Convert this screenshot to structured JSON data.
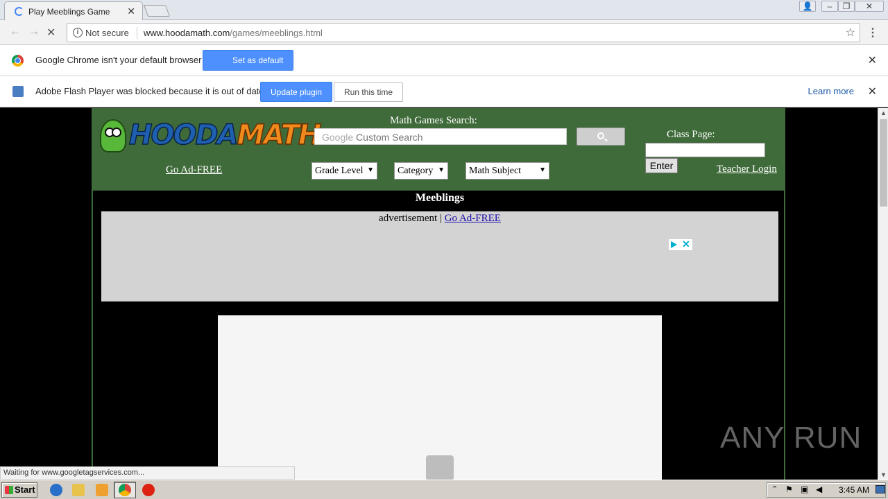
{
  "browser": {
    "tab_title": "Play Meeblings Game",
    "address": {
      "security": "Not secure",
      "host": "www.hoodamath.com",
      "path": "/games/meeblings.html"
    },
    "status_text": "Waiting for www.googletagservices.com..."
  },
  "infobar_default": {
    "message": "Google Chrome isn't your default browser",
    "button": "Set as default"
  },
  "infobar_flash": {
    "message": "Adobe Flash Player was blocked because it is out of date",
    "update_button": "Update plugin",
    "run_button": "Run this time",
    "learn_more": "Learn more"
  },
  "site": {
    "logo_part1": "HOODA",
    "logo_part2": "MATH",
    "go_ad_free": "Go Ad-FREE",
    "search_label": "Math Games Search:",
    "search_brand": "Google",
    "search_placeholder": "Custom Search",
    "filters": [
      "Grade Level",
      "Category",
      "Math Subject"
    ],
    "class_page_label": "Class Page:",
    "enter_button": "Enter",
    "teacher_login": "Teacher Login",
    "game_title": "Meeblings",
    "ad_label": "advertisement |",
    "ad_link": "Go Ad-FREE"
  },
  "watermark": "ANY RUN",
  "taskbar": {
    "start": "Start",
    "clock": "3:45 AM"
  }
}
